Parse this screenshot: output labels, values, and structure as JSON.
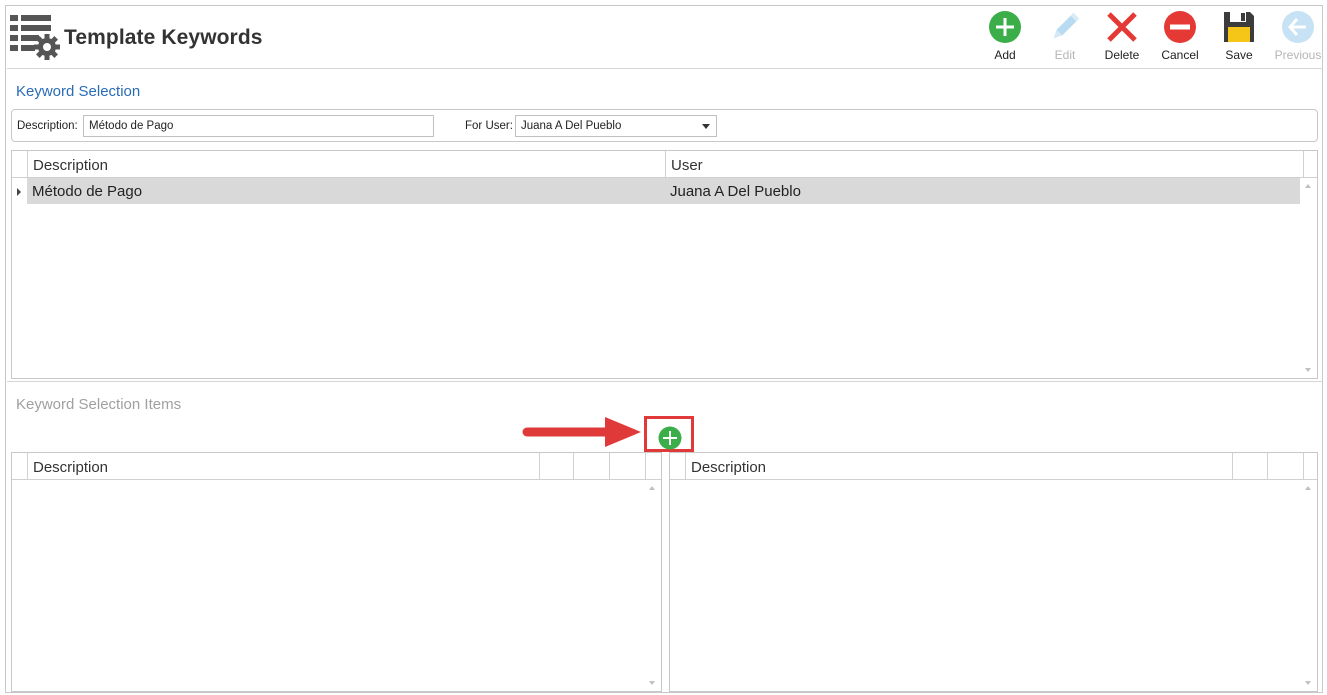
{
  "header": {
    "title": "Template Keywords",
    "app_icon": "list-gear-icon"
  },
  "toolbar": {
    "add": "Add",
    "edit": "Edit",
    "delete": "Delete",
    "cancel": "Cancel",
    "save": "Save",
    "previous": "Previous"
  },
  "colors": {
    "accent_blue": "#2a6cb6",
    "add_green": "#3bae49",
    "delete_red": "#e53935",
    "callout_red": "#e0393a",
    "selected_row": "#d9d9d9"
  },
  "keyword_selection": {
    "title": "Keyword Selection",
    "description_label": "Description:",
    "description_value": "Método de Pago",
    "for_user_label": "For User:",
    "for_user_value": "Juana A Del Pueblo",
    "columns": [
      "Description",
      "User"
    ],
    "rows": [
      {
        "description": "Método de Pago",
        "user": "Juana A Del Pueblo"
      }
    ]
  },
  "keyword_selection_items": {
    "title": "Keyword Selection Items",
    "left_grid_column": "Description",
    "right_grid_column": "Description"
  }
}
